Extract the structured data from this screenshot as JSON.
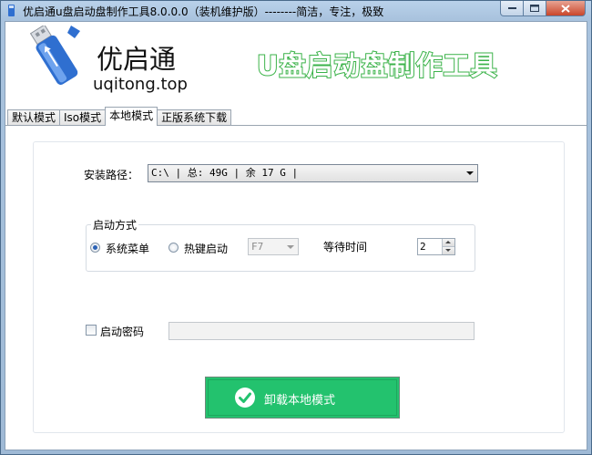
{
  "window": {
    "title": "优启通u盘启动盘制作工具8.0.0.0（装机维护版）--------简洁，专注，极致"
  },
  "caption_buttons": [
    "minimize-icon",
    "maximize-icon",
    "close-icon"
  ],
  "header": {
    "brand_name": "优启通",
    "brand_url": "uqitong.top",
    "slogan": "U盘启动盘制作工具",
    "slogan_color": "#3cb34a",
    "logo_icon": "usb-drive-icon"
  },
  "tabs": [
    {
      "label": "默认模式",
      "active": false
    },
    {
      "label": "Iso模式",
      "active": false
    },
    {
      "label": "本地模式",
      "active": true
    },
    {
      "label": "正版系统下载",
      "active": false
    }
  ],
  "install_path": {
    "label": "安装路径：",
    "value": "C:\\ | 总: 49G | 余 17 G |"
  },
  "boot_mode": {
    "group_title": "启动方式",
    "option_menu": "系统菜单",
    "option_hotkey": "热键启动",
    "selected": "系统菜单",
    "hotkey_value": "F7",
    "wait_label": "等待时间",
    "wait_value": "2"
  },
  "boot_password": {
    "label": "启动密码",
    "checked": false,
    "value": ""
  },
  "action": {
    "label": "卸载本地模式",
    "color": "#23c26e",
    "icon": "check-circle-icon"
  }
}
